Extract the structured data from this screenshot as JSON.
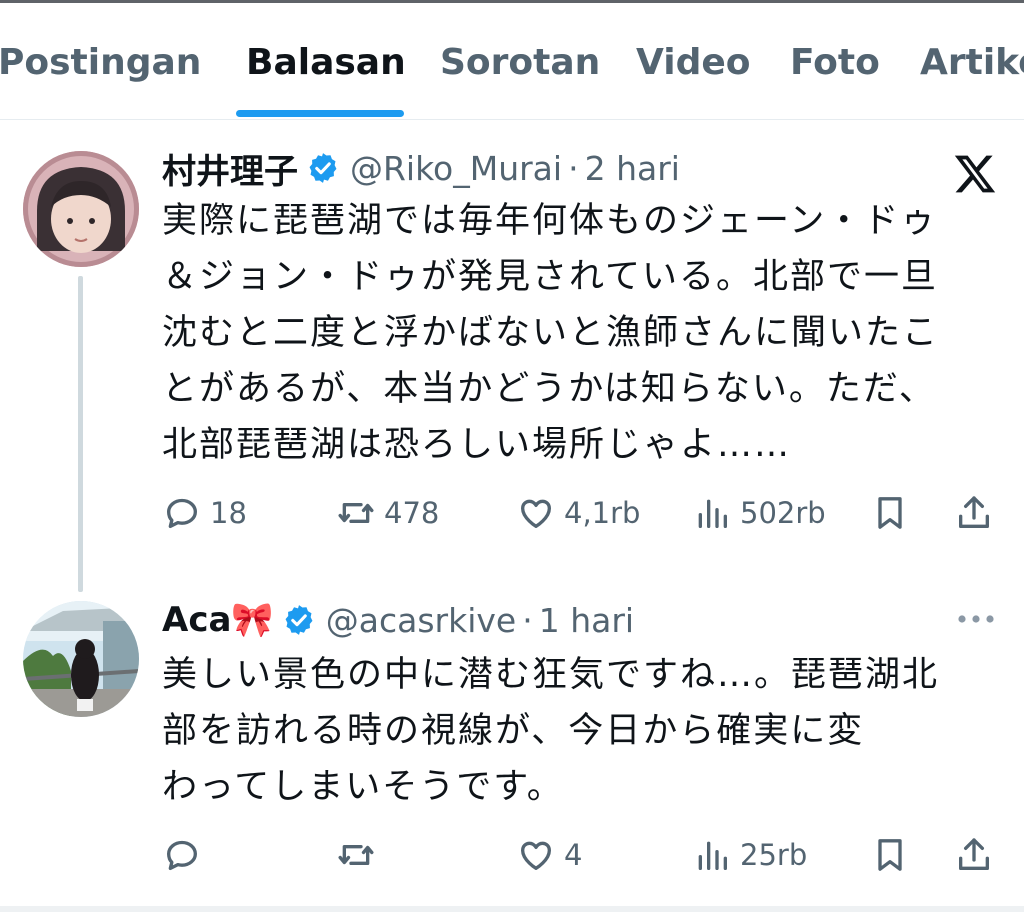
{
  "tabs": [
    {
      "label": "Postingan"
    },
    {
      "label": "Balasan"
    },
    {
      "label": "Sorotan"
    },
    {
      "label": "Video"
    },
    {
      "label": "Foto"
    },
    {
      "label": "Artikel"
    }
  ],
  "active_tab": "Balasan",
  "accent_color": "#1d9bf0",
  "posts": [
    {
      "display_name": "村井理子",
      "handle": "@Riko_Murai",
      "separator": "·",
      "time": "2 hari",
      "verified_icon": "verified-badge-icon",
      "source_icon": "x-logo-icon",
      "text_lines": [
        "実際に琵琶湖では毎年何体ものジェーン・ドゥ",
        "＆ジョン・ドゥが発見されている。北部で一旦",
        "沈むと二度と浮かばないと漁師さんに聞いたこ",
        "とがあるが、本当かどうかは知らない。ただ、",
        "北部琵琶湖は恐ろしい場所じゃよ……"
      ],
      "replies": "18",
      "reposts": "478",
      "likes": "4,1rb",
      "views": "502rb"
    },
    {
      "display_name": "Aca🎀",
      "handle": "@acasrkive",
      "separator": "·",
      "time": "1 hari",
      "verified_icon": "verified-badge-icon",
      "text_lines": [
        "美しい景色の中に潜む狂気ですね…。琵琶湖北",
        "部を訪れる時の視線が、今日から確実に変",
        "わってしまいそうです。"
      ],
      "replies": "",
      "reposts": "",
      "likes": "4",
      "views": "25rb"
    }
  ]
}
